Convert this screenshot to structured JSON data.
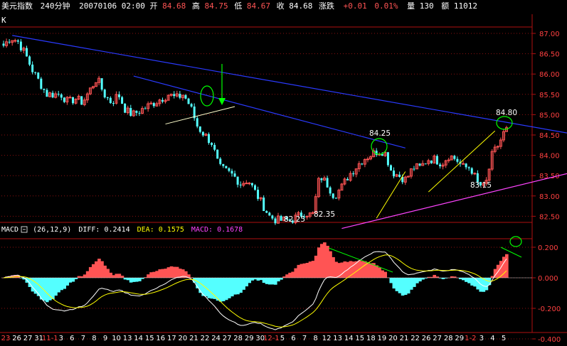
{
  "header": {
    "symbol": "美元指数",
    "period": "240分钟",
    "datetime": "20070106 02:00",
    "open_label": "开",
    "open_value": "84.68",
    "high_label": "高",
    "high_value": "84.75",
    "low_label": "低",
    "low_value": "84.67",
    "close_label": "收",
    "close_value": "84.68",
    "change_label": "涨跌",
    "change_value": "+0.01",
    "change_pct": "0.01%",
    "volume_label": "量",
    "volume_value": "130",
    "amount_label": "额",
    "amount_value": "11012"
  },
  "price_panel": {
    "corner_label": "K",
    "y_ticks": [
      "87.00",
      "86.50",
      "86.00",
      "85.50",
      "85.00",
      "84.50",
      "84.00",
      "83.50",
      "83.00",
      "82.50"
    ],
    "annotations": [
      "84.80",
      "84.25",
      "83.15",
      "82.35",
      "82.25"
    ]
  },
  "macd_panel": {
    "name": "MACD",
    "params": "(26,12,9)",
    "diff_label": "DIFF:",
    "diff_value": "0.2414",
    "dea_label": "DEA:",
    "dea_value": "0.1575",
    "macd_label": "MACD:",
    "macd_value": "0.1678",
    "y_ticks": [
      "0.200",
      "0.000",
      "-0.200",
      "-0.400"
    ]
  },
  "x_axis": {
    "labels": [
      "23",
      "26",
      "27",
      "31",
      "11-1",
      "3",
      "6",
      "7",
      "8",
      "9",
      "10",
      "13",
      "14",
      "15",
      "16",
      "17",
      "20",
      "21",
      "22",
      "24",
      "27",
      "28",
      "29",
      "30",
      "12-1",
      "5",
      "6",
      "7",
      "8",
      "12",
      "13",
      "14",
      "15",
      "18",
      "19",
      "20",
      "21",
      "22",
      "26",
      "27",
      "28",
      "29",
      "1-2",
      "3",
      "4",
      "5"
    ]
  },
  "colors": {
    "up": "#ff5454",
    "down": "#54ffff",
    "diff_line": "#ffffff",
    "dea_line": "#ffff00",
    "trend_line": "#2a3aff",
    "support_line": "#ff44ff",
    "grid": "#8b1010",
    "annotation_green": "#00ff00"
  },
  "chart_data": [
    {
      "type": "candlestick",
      "title": "美元指数 240分钟",
      "ylim": [
        82.25,
        87.2
      ],
      "x_range": [
        "23",
        "5"
      ],
      "key_points": [
        {
          "label": "84.80",
          "value": 84.8
        },
        {
          "label": "84.25",
          "value": 84.25
        },
        {
          "label": "83.15",
          "value": 83.15
        },
        {
          "label": "82.35",
          "value": 82.35
        },
        {
          "label": "82.25",
          "value": 82.25
        }
      ],
      "last_bar": {
        "open": 84.68,
        "high": 84.75,
        "low": 84.67,
        "close": 84.68
      },
      "close_path": [
        86.7,
        86.9,
        86.8,
        86.5,
        86.1,
        85.8,
        85.5,
        85.5,
        85.5,
        85.3,
        85.4,
        85.3,
        85.6,
        85.9,
        85.5,
        85.3,
        85.5,
        85.1,
        85.0,
        85.1,
        85.2,
        85.3,
        85.4,
        85.5,
        85.4,
        85.5,
        85.2,
        84.7,
        84.5,
        84.3,
        83.7,
        83.6,
        83.5,
        83.3,
        83.4,
        83.1,
        82.8,
        82.5,
        82.4,
        82.4,
        82.4,
        82.5,
        82.6,
        82.5,
        83.5,
        83.3,
        83.0,
        83.2,
        83.5,
        83.7,
        83.9,
        84.0,
        84.1,
        84.1,
        83.6,
        83.5,
        83.4,
        83.7,
        83.7,
        83.9,
        83.9,
        83.8,
        84.0,
        83.9,
        83.7,
        83.7,
        83.3,
        83.2,
        84.0,
        84.3,
        84.7
      ]
    },
    {
      "type": "macd",
      "params": "(26,12,9)",
      "ylim": [
        -0.4,
        0.28
      ],
      "series": [
        {
          "name": "DIFF",
          "last": 0.2414
        },
        {
          "name": "DEA",
          "last": 0.1575
        },
        {
          "name": "MACD",
          "last": 0.1678
        }
      ]
    }
  ]
}
